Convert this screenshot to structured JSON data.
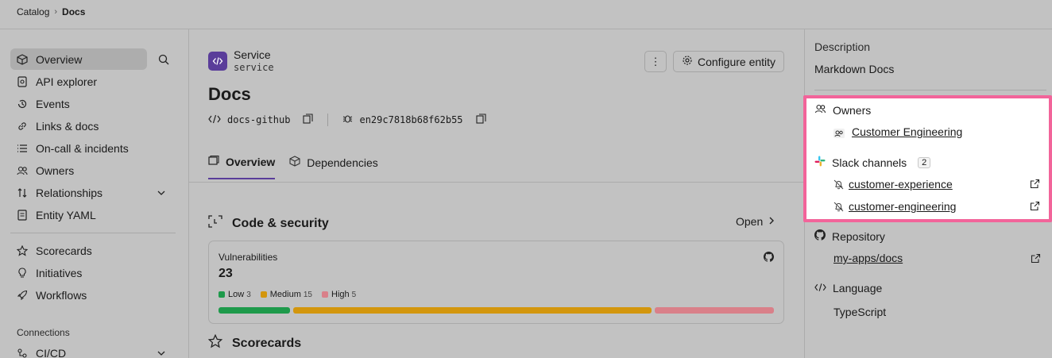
{
  "breadcrumb": {
    "parent": "Catalog",
    "current": "Docs"
  },
  "sidebar": {
    "items": [
      {
        "label": "Overview",
        "icon": "cube-icon",
        "active": true
      },
      {
        "label": "API explorer",
        "icon": "api-icon"
      },
      {
        "label": "Events",
        "icon": "history-icon"
      },
      {
        "label": "Links & docs",
        "icon": "link-icon"
      },
      {
        "label": "On-call & incidents",
        "icon": "list-icon"
      },
      {
        "label": "Owners",
        "icon": "users-icon"
      },
      {
        "label": "Relationships",
        "icon": "sort-icon"
      },
      {
        "label": "Entity YAML",
        "icon": "file-icon"
      }
    ],
    "items2": [
      {
        "label": "Scorecards",
        "icon": "star-icon"
      },
      {
        "label": "Initiatives",
        "icon": "bulb-icon"
      },
      {
        "label": "Workflows",
        "icon": "rocket-icon"
      }
    ],
    "connections_heading": "Connections",
    "cicd_label": "CI/CD"
  },
  "entity": {
    "kind": "Service",
    "type": "service",
    "title": "Docs",
    "repo_id": "docs-github",
    "hash": "en29c7818b68f62b55",
    "more_label": "⋮",
    "configure_label": "Configure entity"
  },
  "tabs": [
    {
      "label": "Overview",
      "active": true
    },
    {
      "label": "Dependencies"
    }
  ],
  "code_security": {
    "title": "Code & security",
    "open_label": "Open",
    "vulnerabilities_label": "Vulnerabilities",
    "vulnerabilities_total": "23",
    "low": {
      "label": "Low",
      "count": 3,
      "color": "#1e9a4b"
    },
    "medium": {
      "label": "Medium",
      "count": 15,
      "color": "#d3960d"
    },
    "high": {
      "label": "High",
      "count": 5,
      "color": "#d98089"
    }
  },
  "scorecards_title": "Scorecards",
  "right": {
    "description_label": "Description",
    "description_value": "Markdown Docs",
    "owners_label": "Owners",
    "owner_name": "Customer Engineering",
    "slack_label": "Slack channels",
    "slack_count": "2",
    "slack_channels": [
      "customer-experience",
      "customer-engineering"
    ],
    "repository_label": "Repository",
    "repository_value": "my-apps/docs",
    "language_label": "Language",
    "language_value": "TypeScript"
  },
  "colors": {
    "accent": "#5a3d9a",
    "highlight": "#f2649a"
  }
}
